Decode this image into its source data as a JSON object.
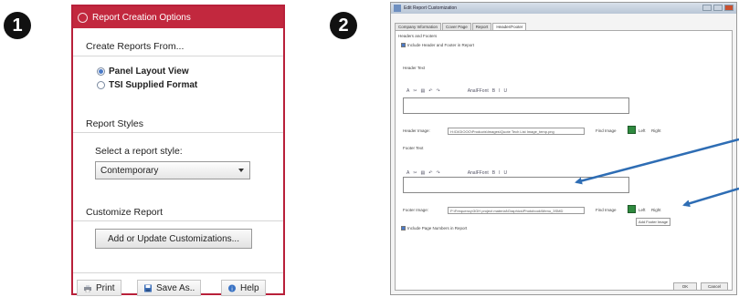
{
  "badges": {
    "one": "1",
    "two": "2"
  },
  "panel1": {
    "title": "Report Creation Options",
    "create_from_label": "Create Reports From...",
    "radio_panel_layout": "Panel Layout View",
    "radio_tsi_format": "TSI Supplied Format",
    "report_styles_label": "Report Styles",
    "select_style_label": "Select a report style:",
    "style_value": "Contemporary",
    "customize_label": "Customize Report",
    "customize_button": "Add or Update Customizations...",
    "print_button": "Print",
    "save_as_button": "Save As..",
    "help_button": "Help"
  },
  "panel2": {
    "window_title": "Edit Report Customization",
    "tabs": [
      "Company Information",
      "Cover Page",
      "Report",
      "Header/Footer"
    ],
    "section_title": "Headers and Footers",
    "include_header_footer": "Include Header and Footer in Report",
    "header_text_label": "Header Text",
    "header_image_label": "Header Image:",
    "header_image_path": "H:\\DIGIOOO\\Products\\Images\\Quote Tech List Image_temp.png",
    "find_image_label": "Find Image",
    "left_label": "Left",
    "right_label": "Right",
    "footer_text_label": "Footer Text",
    "footer_image_label": "Footer Image:",
    "footer_image_path": "P:\\Frequency\\3GH project material\\Graphics\\Photobook\\Menu_3SMD",
    "tooltip": "Add Footer Image",
    "include_page_numbers": "Include Page Numbers in Report",
    "toolbar_font": "AnalFFont",
    "ok_button": "OK",
    "cancel_button": "Cancel"
  },
  "colors": {
    "accent": "#c2283e",
    "arrow": "#2e6db4"
  }
}
